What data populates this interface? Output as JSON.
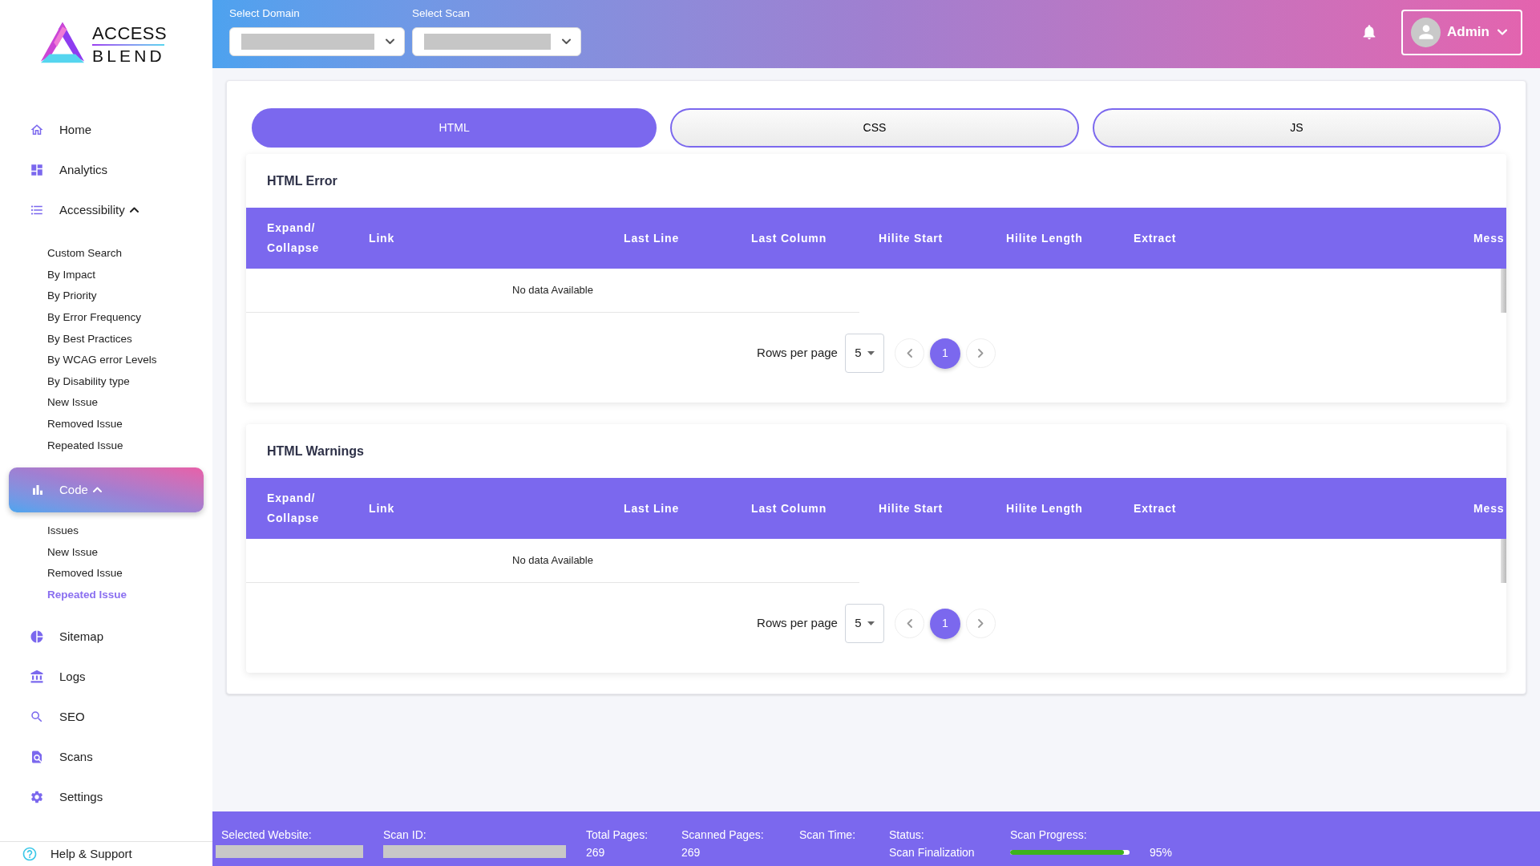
{
  "sidebar": {
    "logo": {
      "line_1": "ACCESS",
      "line_2": "BLEND"
    },
    "items": [
      {
        "label": "Home",
        "selected": false
      },
      {
        "label": "Analytics",
        "selected": false
      },
      {
        "label": "Accessibility",
        "selected": false,
        "expanded": true,
        "children": [
          {
            "label": "Custom Search",
            "selected": false
          },
          {
            "label": "By Impact",
            "selected": false
          },
          {
            "label": "By Priority",
            "selected": false
          },
          {
            "label": "By Error Frequency",
            "selected": false
          },
          {
            "label": "By Best Practices",
            "selected": false
          },
          {
            "label": "By WCAG error Levels",
            "selected": false
          },
          {
            "label": "By Disability type",
            "selected": false
          },
          {
            "label": "New Issue",
            "selected": false
          },
          {
            "label": "Removed Issue",
            "selected": false
          },
          {
            "label": "Repeated Issue",
            "selected": false
          }
        ]
      },
      {
        "label": "Code",
        "selected": true,
        "expanded": true,
        "children": [
          {
            "label": "Issues",
            "selected": false
          },
          {
            "label": "New Issue",
            "selected": false
          },
          {
            "label": "Removed Issue",
            "selected": false
          },
          {
            "label": "Repeated Issue",
            "selected": true
          }
        ]
      },
      {
        "label": "Sitemap",
        "selected": false
      },
      {
        "label": "Logs",
        "selected": false
      },
      {
        "label": "SEO",
        "selected": false
      },
      {
        "label": "Scans",
        "selected": false
      },
      {
        "label": "Settings",
        "selected": false
      }
    ],
    "help": {
      "label": "Help & Support"
    }
  },
  "top_bar": {
    "filters": [
      {
        "label": "Select Domain",
        "value_redacted": true
      },
      {
        "label": "Select Scan",
        "value_redacted": true
      }
    ],
    "user": {
      "name": "Admin"
    }
  },
  "tabs": [
    {
      "label": "HTML",
      "selected": true
    },
    {
      "label": "CSS",
      "selected": false
    },
    {
      "label": "JS",
      "selected": false
    }
  ],
  "sections": [
    {
      "title": "HTML Error",
      "columns": [
        "Expand/ Collapse",
        "Link",
        "Last Line",
        "Last Column",
        "Hilite Start",
        "Hilite Length",
        "Extract",
        "Mess"
      ],
      "empty_message": "No data Available",
      "pagination": {
        "label": "Rows per page",
        "rows_per_page": "5",
        "pages": [
          {
            "label": "1",
            "selected": true
          }
        ]
      }
    },
    {
      "title": "HTML Warnings",
      "columns": [
        "Expand/ Collapse",
        "Link",
        "Last Line",
        "Last Column",
        "Hilite Start",
        "Hilite Length",
        "Extract",
        "Mess"
      ],
      "empty_message": "No data Available",
      "pagination": {
        "label": "Rows per page",
        "rows_per_page": "5",
        "pages": [
          {
            "label": "1",
            "selected": true
          }
        ]
      }
    }
  ],
  "status_bar": {
    "items": [
      {
        "kind": "redacted",
        "label": "Selected Website:"
      },
      {
        "kind": "redacted",
        "label": "Scan ID:"
      },
      {
        "kind": "text",
        "label": "Total Pages:",
        "value": "269"
      },
      {
        "kind": "text",
        "label": "Scanned Pages:",
        "value": "269"
      },
      {
        "kind": "text",
        "label": "Scan Time:"
      },
      {
        "kind": "text",
        "label": "Status:",
        "value": "Scan Finalization"
      },
      {
        "kind": "progress",
        "label": "Scan Progress:",
        "level": 0.95,
        "reading": "95%"
      }
    ]
  }
}
